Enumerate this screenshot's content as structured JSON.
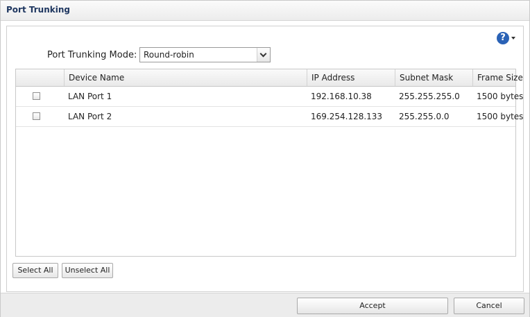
{
  "window": {
    "title": "Port Trunking"
  },
  "help": {
    "icon": "help-icon",
    "symbol": "?"
  },
  "mode": {
    "label": "Port Trunking Mode:",
    "selected": "Round-robin"
  },
  "table": {
    "columns": [
      "",
      "Device Name",
      "IP Address",
      "Subnet Mask",
      "Frame Size"
    ],
    "rows": [
      {
        "checked": false,
        "device": "LAN Port 1",
        "ip": "192.168.10.38",
        "mask": "255.255.255.0",
        "frame": "1500 bytes"
      },
      {
        "checked": false,
        "device": "LAN Port 2",
        "ip": "169.254.128.133",
        "mask": "255.255.0.0",
        "frame": "1500 bytes"
      }
    ]
  },
  "actions": {
    "select_all": "Select All",
    "unselect_all": "Unselect All"
  },
  "footer": {
    "accept": "Accept",
    "cancel": "Cancel"
  }
}
